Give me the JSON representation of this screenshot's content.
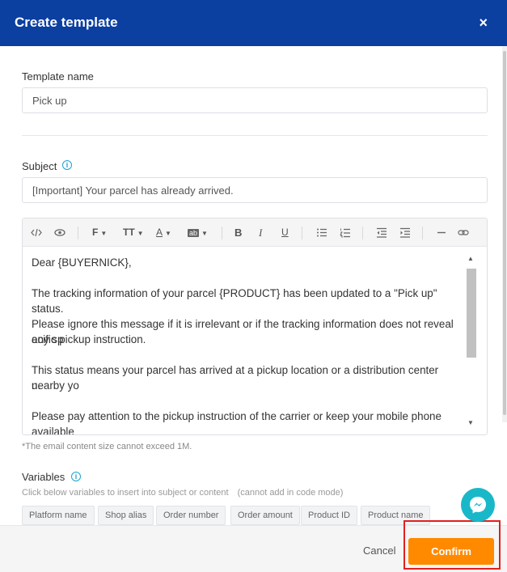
{
  "dialog": {
    "title": "Create template",
    "close_glyph": "×"
  },
  "template_name": {
    "label": "Template name",
    "value": "Pick up"
  },
  "subject": {
    "label": "Subject",
    "value": "[Important] Your parcel has already arrived."
  },
  "toolbar": {
    "code_icon": "code-icon",
    "preview_icon": "eye-icon",
    "font_label": "F",
    "font_size_label": "TT",
    "font_color_label": "A",
    "highlight_label": "ab",
    "bold_label": "B",
    "italic_label": "I",
    "underline_label": "U"
  },
  "editor": {
    "paragraphs": [
      "Dear {BUYERNICK},",
      "The tracking information of your parcel {PRODUCT} has been updated to a \"Pick up\" status.",
      "Please ignore this message if it is irrelevant or if the tracking information does not reveal any sp",
      "ecific pickup instruction.",
      "This status means your parcel has arrived at a pickup location or a distribution center nearby yo",
      "u.",
      "Please pay attention to the pickup instruction of the carrier or keep your mobile phone available"
    ]
  },
  "note": "*The email content size cannot exceed 1M.",
  "variables": {
    "label": "Variables",
    "hint": "Click below variables to insert into subject or content　(cannot add in code mode)",
    "chips": [
      "Platform name",
      "Shop alias",
      "Order number",
      "Order amount",
      "Product ID",
      "Product name"
    ]
  },
  "footer": {
    "cancel_label": "Cancel",
    "confirm_label": "Confirm"
  },
  "colors": {
    "header": "#0b3fa0",
    "confirm": "#ff8a00",
    "info": "#1aa3d4",
    "messenger": "#19b8c9",
    "highlight": "#e02020"
  }
}
